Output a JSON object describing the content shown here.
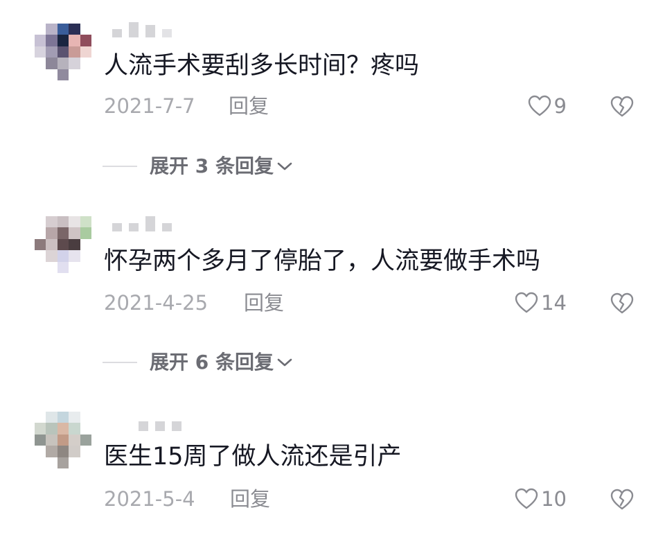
{
  "comments": [
    {
      "text": "人流手术要刮多长时间？疼吗",
      "date": "2021-7-7",
      "reply_label": "回复",
      "likes": "9",
      "expand_label": "展开 3 条回复"
    },
    {
      "text": "怀孕两个多月了停胎了，人流要做手术吗",
      "date": "2021-4-25",
      "reply_label": "回复",
      "likes": "14",
      "expand_label": "展开 6 条回复"
    },
    {
      "text": "医生15周了做人流还是引产",
      "date": "2021-5-4",
      "reply_label": "回复",
      "likes": "10"
    }
  ],
  "icons": {
    "like": "heart-outline-icon",
    "dislike": "broken-heart-icon",
    "expand": "chevron-down-icon"
  },
  "colors": {
    "text": "#161823",
    "meta": "#a8a9ae",
    "action": "#8a8b91",
    "expand": "#6b6c73"
  }
}
